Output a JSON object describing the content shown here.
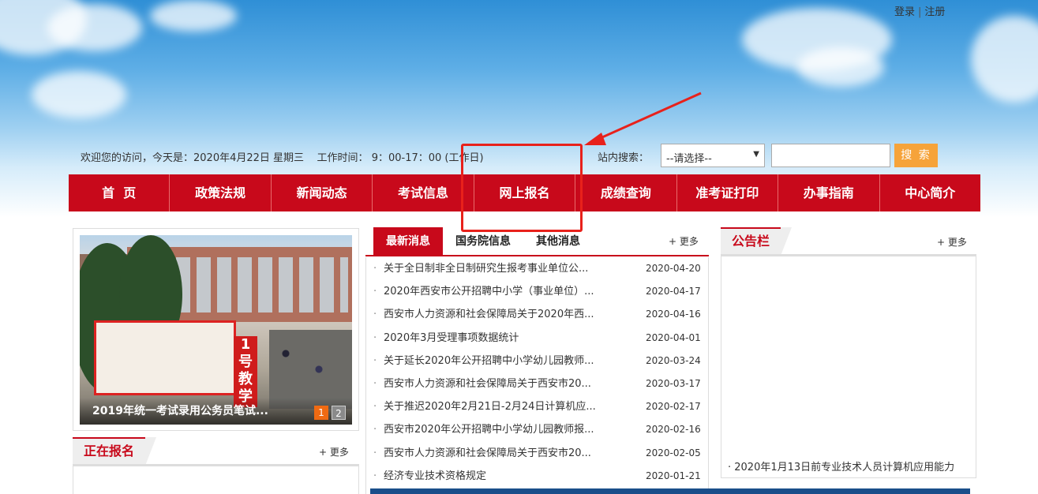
{
  "header": {
    "login": "登录",
    "separator": "|",
    "register": "注册"
  },
  "info_bar": {
    "welcome": "欢迎您的访问，今天是：2020年4月22日 星期三    工作时间： 9：00-17：00 (工作日)",
    "search_label": "站内搜索：",
    "select_value": "--请选择--",
    "search_input_value": "",
    "search_button": "搜 索"
  },
  "nav": {
    "items": [
      {
        "label": "首  页"
      },
      {
        "label": "政策法规"
      },
      {
        "label": "新闻动态"
      },
      {
        "label": "考试信息"
      },
      {
        "label": "网上报名"
      },
      {
        "label": "成绩查询"
      },
      {
        "label": "准考证打印"
      },
      {
        "label": "办事指南"
      },
      {
        "label": "中心简介"
      }
    ]
  },
  "slider": {
    "caption": "2019年统一考试录用公务员笔试...",
    "banner_text": "1号教学",
    "pages": [
      "1",
      "2"
    ]
  },
  "news": {
    "tabs": [
      {
        "label": "最新消息"
      },
      {
        "label": "国务院信息"
      },
      {
        "label": "其他消息"
      }
    ],
    "more": "+ 更多",
    "bullet": "·",
    "items": [
      {
        "title": "关于全日制非全日制研究生报考事业单位公...",
        "date": "2020-04-20"
      },
      {
        "title": "2020年西安市公开招聘中小学（事业单位）...",
        "date": "2020-04-17"
      },
      {
        "title": "西安市人力资源和社会保障局关于2020年西...",
        "date": "2020-04-16"
      },
      {
        "title": "2020年3月受理事项数据统计",
        "date": "2020-04-01"
      },
      {
        "title": "关于延长2020年公开招聘中小学幼儿园教师...",
        "date": "2020-03-24"
      },
      {
        "title": "西安市人力资源和社会保障局关于西安市20...",
        "date": "2020-03-17"
      },
      {
        "title": "关于推迟2020年2月21日-2月24日计算机应...",
        "date": "2020-02-17"
      },
      {
        "title": "西安市2020年公开招聘中小学幼儿园教师报...",
        "date": "2020-02-16"
      },
      {
        "title": "西安市人力资源和社会保障局关于西安市20...",
        "date": "2020-02-05"
      },
      {
        "title": "经济专业技术资格规定",
        "date": "2020-01-21"
      }
    ]
  },
  "notice": {
    "title": "公告栏",
    "more": "+ 更多",
    "item": "· 2020年1月13日前专业技术人员计算机应用能力"
  },
  "signup": {
    "title": "正在报名",
    "more": "+ 更多"
  },
  "colors": {
    "nav_red": "#c8091b",
    "search_orange": "#f6a33a",
    "annotation_red": "#e8211b"
  }
}
